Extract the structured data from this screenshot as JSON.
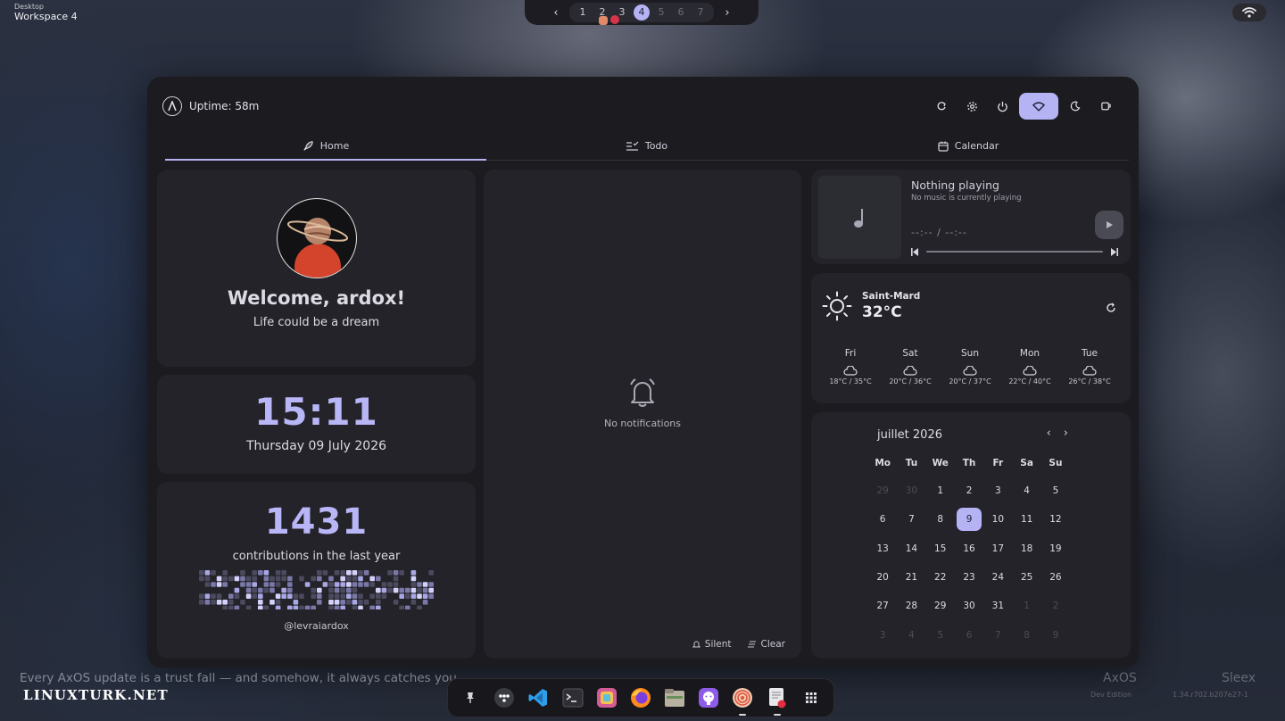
{
  "topbar": {
    "desktop_small": "Desktop",
    "workspace_label": "Workspace 4",
    "workspaces": [
      "1",
      "2",
      "3",
      "4",
      "5",
      "6",
      "7"
    ],
    "active_workspace": "4",
    "prev_arrow": "‹",
    "next_arrow": "›"
  },
  "header": {
    "uptime": "Uptime: 58m"
  },
  "tabs": [
    {
      "label": "Home",
      "icon": "rocket-icon",
      "active": true
    },
    {
      "label": "Todo",
      "icon": "checklist-icon",
      "active": false
    },
    {
      "label": "Calendar",
      "icon": "calendar-icon",
      "active": false
    }
  ],
  "welcome": {
    "title": "Welcome, ardox!",
    "subtitle": "Life could be a dream"
  },
  "clock": {
    "time": "15:11",
    "date": "Thursday 09 July 2026"
  },
  "contributions": {
    "count": "1431",
    "label": "contributions in the last year",
    "user": "@levraiardox"
  },
  "notifications": {
    "empty_text": "No notifications",
    "silent_label": "Silent",
    "clear_label": "Clear"
  },
  "music": {
    "title": "Nothing playing",
    "subtitle": "No music is currently playing",
    "time": "--:-- / --:--"
  },
  "weather": {
    "location": "Saint-Mard",
    "temperature": "32°C",
    "forecast": [
      {
        "day": "Fri",
        "range": "18°C / 35°C"
      },
      {
        "day": "Sat",
        "range": "20°C / 36°C"
      },
      {
        "day": "Sun",
        "range": "20°C / 37°C"
      },
      {
        "day": "Mon",
        "range": "22°C / 40°C"
      },
      {
        "day": "Tue",
        "range": "26°C / 38°C"
      }
    ]
  },
  "calendar": {
    "month": "juillet 2026",
    "prev": "‹",
    "next": "›",
    "weekdays": [
      "Mo",
      "Tu",
      "We",
      "Th",
      "Fr",
      "Sa",
      "Su"
    ],
    "days": [
      [
        "29",
        "30",
        "1",
        "2",
        "3",
        "4",
        "5"
      ],
      [
        "6",
        "7",
        "8",
        "9",
        "10",
        "11",
        "12"
      ],
      [
        "13",
        "14",
        "15",
        "16",
        "17",
        "18",
        "19"
      ],
      [
        "20",
        "21",
        "22",
        "23",
        "24",
        "25",
        "26"
      ],
      [
        "27",
        "28",
        "29",
        "30",
        "31",
        "1",
        "2"
      ],
      [
        "3",
        "4",
        "5",
        "6",
        "7",
        "8",
        "9"
      ]
    ],
    "today": "9"
  },
  "desktop": {
    "quote": "Every AxOS update is a trust fall — and somehow, it always catches you.",
    "brand_left": "AxOS",
    "brand_left_sub": "Dev Edition",
    "brand_right": "Sleex",
    "brand_right_sub": "1.34.r702.b207e27-1",
    "watermark": "LINUXTURK.NET"
  },
  "dock": [
    "pin-icon",
    "launcher-icon",
    "vscode-icon",
    "terminal-icon",
    "app-icon",
    "firefox-icon",
    "files-icon",
    "github-icon",
    "record-icon",
    "notes-icon",
    "app-grid-icon"
  ],
  "colors": {
    "accent": "#b6b3f5",
    "panel": "#1b1b20",
    "card": "#232329"
  }
}
